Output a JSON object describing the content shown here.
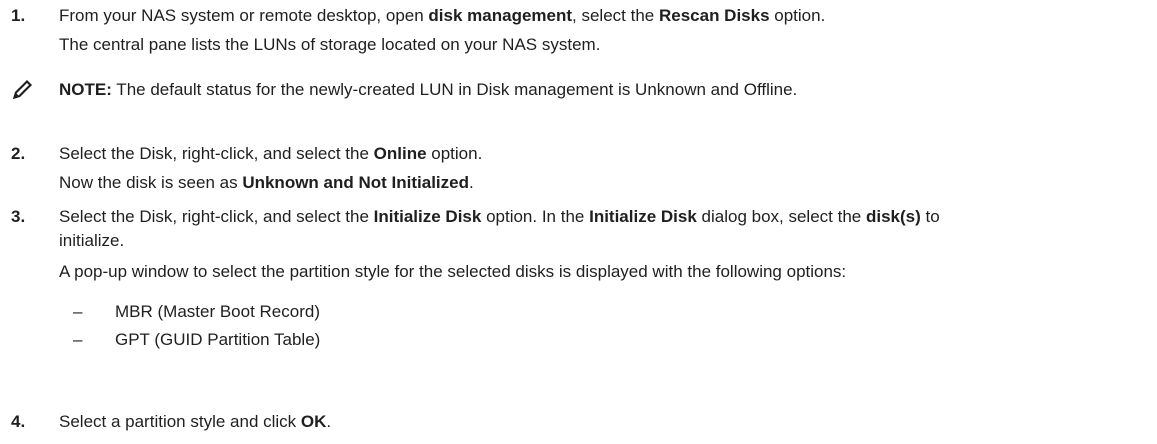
{
  "steps": [
    {
      "number": "1.",
      "line1": {
        "t1": "From your NAS system or remote desktop, open ",
        "b1": "disk management",
        "t2": ", select the ",
        "b2": "Rescan Disks",
        "t3": " option."
      },
      "line2": "The central pane lists the LUNs of storage located on your NAS system."
    },
    {
      "number": "2.",
      "line1": {
        "t1": "Select the Disk, right-click, and select the ",
        "b1": "Online",
        "t2": " option."
      },
      "line2": {
        "t1": "Now the disk is seen as ",
        "b1": "Unknown and Not Initialized",
        "t2": "."
      }
    },
    {
      "number": "3.",
      "line1": {
        "t1": "Select the Disk, right-click, and select the ",
        "b1": "Initialize Disk",
        "t2": " option. In the ",
        "b2": "Initialize Disk",
        "t3": " dialog box, select the ",
        "b3": "disk(s)",
        "t4": " to",
        "t5": "initialize."
      },
      "line2": "A pop-up window to select the partition style for the selected disks is displayed with the following options:",
      "bullets": [
        "MBR (Master Boot Record)",
        "GPT (GUID Partition Table)"
      ],
      "bullet_dash": "–"
    },
    {
      "number": "4.",
      "line1": {
        "t1": "Select a partition style and click ",
        "b1": "OK",
        "t2": "."
      }
    }
  ],
  "note": {
    "icon": "pencil-note-icon",
    "label": "NOTE:",
    "text": " The default status for the newly-created LUN in Disk management is Unknown and Offline."
  }
}
